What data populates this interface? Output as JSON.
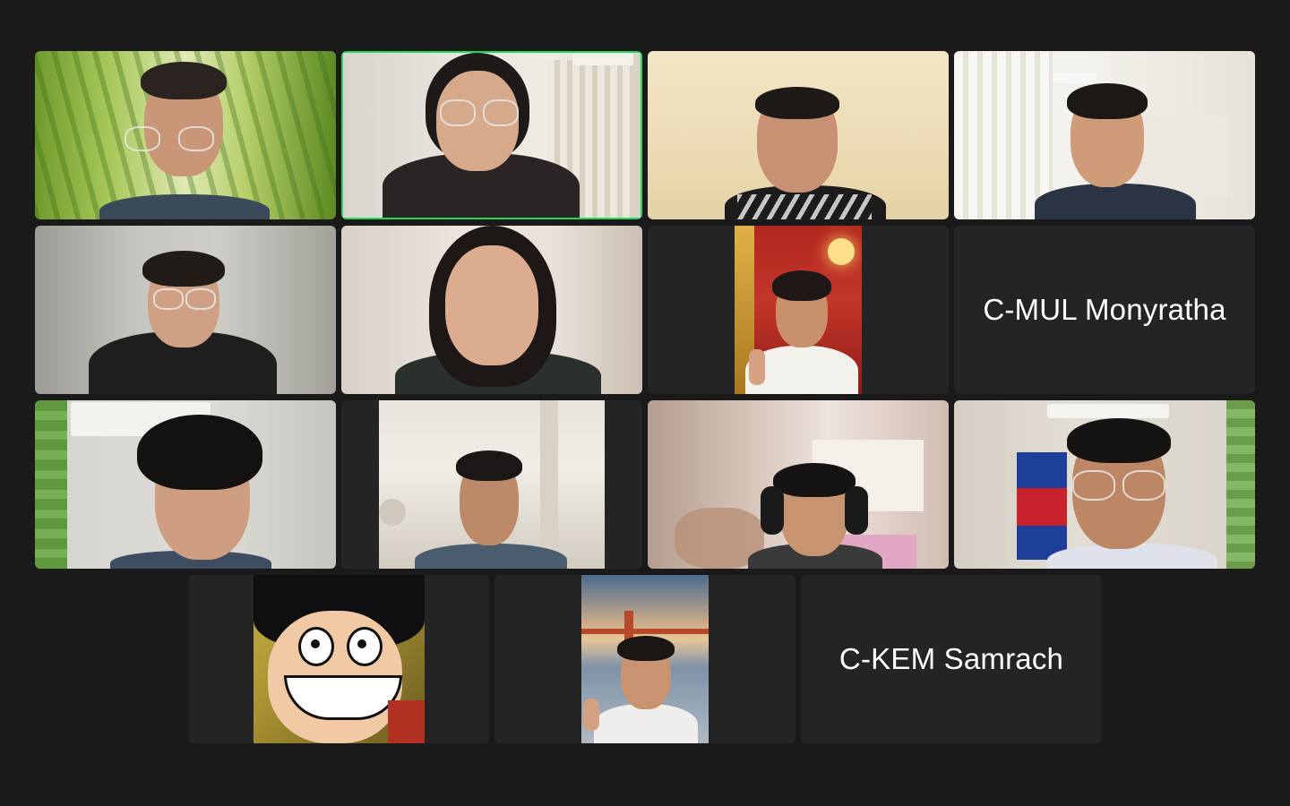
{
  "grid": {
    "participants": [
      {
        "id": "p1",
        "name": ""
      },
      {
        "id": "p2",
        "name": "",
        "active_speaker": true
      },
      {
        "id": "p3",
        "name": ""
      },
      {
        "id": "p4",
        "name": ""
      },
      {
        "id": "p5",
        "name": ""
      },
      {
        "id": "p6",
        "name": ""
      },
      {
        "id": "p7",
        "name": ""
      },
      {
        "id": "p8",
        "name": "C-MUL Monyratha",
        "video_off": true
      },
      {
        "id": "p9",
        "name": ""
      },
      {
        "id": "p10",
        "name": ""
      },
      {
        "id": "p11",
        "name": ""
      },
      {
        "id": "p12",
        "name": ""
      },
      {
        "id": "p13",
        "name": ""
      },
      {
        "id": "p14",
        "name": ""
      },
      {
        "id": "p15",
        "name": "C-KEM Samrach",
        "video_off": true
      }
    ]
  },
  "colors": {
    "background": "#1a1a1a",
    "tile": "#242424",
    "active_speaker_border": "#23d959"
  }
}
